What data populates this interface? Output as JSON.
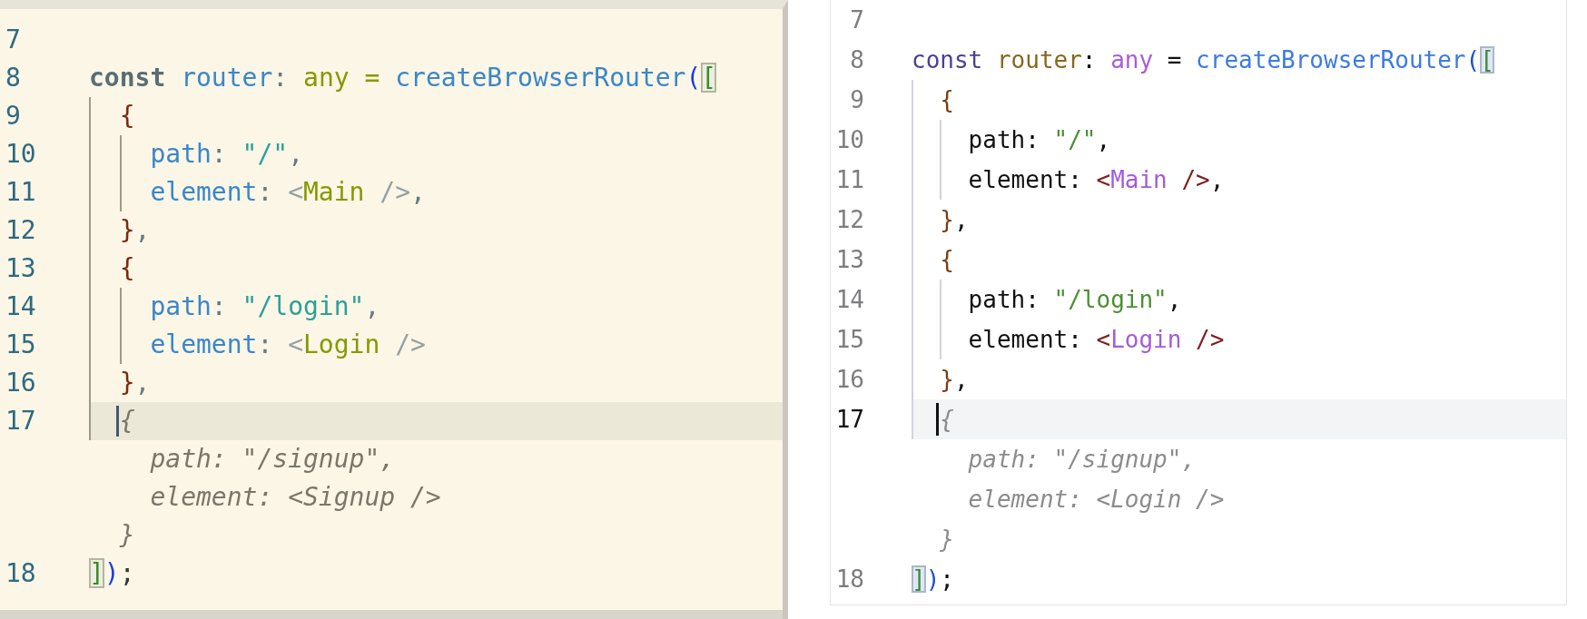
{
  "panes": [
    {
      "kind": "solarized",
      "lines": [
        {
          "number": "7",
          "current": false
        },
        {
          "number": "8",
          "current": false,
          "tokens": [
            {
              "text": "const",
              "kind": "kw"
            },
            {
              "text": " router",
              "kind": "var"
            },
            {
              "text": ": ",
              "kind": "punct"
            },
            {
              "text": "any",
              "kind": "type"
            },
            {
              "text": " = ",
              "kind": "op"
            },
            {
              "text": "createBrowserRouter",
              "kind": "fn"
            },
            {
              "text": "(",
              "kind": "paren"
            },
            {
              "text": "[",
              "kind": "match"
            }
          ]
        },
        {
          "number": "9",
          "current": false,
          "tokens": [
            {
              "text": "  {",
              "kind": "brace"
            }
          ]
        },
        {
          "number": "10",
          "current": false,
          "tokens": [
            {
              "text": "    path",
              "kind": "prop"
            },
            {
              "text": ": ",
              "kind": "punct"
            },
            {
              "text": "\"/\"",
              "kind": "str"
            },
            {
              "text": ",",
              "kind": "punct"
            }
          ]
        },
        {
          "number": "11",
          "current": false,
          "tokens": [
            {
              "text": "    element",
              "kind": "prop"
            },
            {
              "text": ": ",
              "kind": "punct"
            },
            {
              "text": "<",
              "kind": "tagp"
            },
            {
              "text": "Main",
              "kind": "comp"
            },
            {
              "text": " />",
              "kind": "tagp"
            },
            {
              "text": ",",
              "kind": "punct"
            }
          ]
        },
        {
          "number": "12",
          "current": false,
          "tokens": [
            {
              "text": "  }",
              "kind": "brace"
            },
            {
              "text": ",",
              "kind": "punct"
            }
          ]
        },
        {
          "number": "13",
          "current": false,
          "tokens": [
            {
              "text": "  {",
              "kind": "brace"
            }
          ]
        },
        {
          "number": "14",
          "current": false,
          "tokens": [
            {
              "text": "    path",
              "kind": "prop"
            },
            {
              "text": ": ",
              "kind": "punct"
            },
            {
              "text": "\"/login\"",
              "kind": "str"
            },
            {
              "text": ",",
              "kind": "punct"
            }
          ]
        },
        {
          "number": "15",
          "current": false,
          "tokens": [
            {
              "text": "    element",
              "kind": "prop"
            },
            {
              "text": ": ",
              "kind": "punct"
            },
            {
              "text": "<",
              "kind": "tagp"
            },
            {
              "text": "Login",
              "kind": "comp"
            },
            {
              "text": " />",
              "kind": "tagp"
            }
          ]
        },
        {
          "number": "16",
          "current": false,
          "tokens": [
            {
              "text": "  }",
              "kind": "brace"
            },
            {
              "text": ",",
              "kind": "punct"
            }
          ]
        },
        {
          "number": "17",
          "current": true,
          "tokens": [
            {
              "text": "  {",
              "kind": "ghost"
            }
          ]
        },
        {
          "current": false,
          "tokens": [
            {
              "text": "    path: \"/signup\",",
              "kind": "ghost"
            }
          ]
        },
        {
          "current": false,
          "tokens": [
            {
              "text": "    element: <Signup />",
              "kind": "ghost"
            }
          ]
        },
        {
          "current": false,
          "tokens": [
            {
              "text": "  }",
              "kind": "ghost"
            }
          ]
        },
        {
          "number": "18",
          "current": false,
          "tokens": [
            {
              "text": "]",
              "kind": "match"
            },
            {
              "text": ")",
              "kind": "paren"
            },
            {
              "text": ";",
              "kind": "end"
            }
          ]
        }
      ]
    },
    {
      "kind": "light",
      "lines": [
        {
          "number": "7",
          "current": false
        },
        {
          "number": "8",
          "current": false,
          "tokens": [
            {
              "text": "const",
              "kind": "kw"
            },
            {
              "text": " router",
              "kind": "var"
            },
            {
              "text": ": ",
              "kind": "punct"
            },
            {
              "text": "any",
              "kind": "type"
            },
            {
              "text": " = ",
              "kind": "op"
            },
            {
              "text": "createBrowserRouter",
              "kind": "fn"
            },
            {
              "text": "(",
              "kind": "paren"
            },
            {
              "text": "[",
              "kind": "match"
            }
          ]
        },
        {
          "number": "9",
          "current": false,
          "tokens": [
            {
              "text": "  {",
              "kind": "brace"
            }
          ]
        },
        {
          "number": "10",
          "current": false,
          "tokens": [
            {
              "text": "    path",
              "kind": "prop"
            },
            {
              "text": ": ",
              "kind": "punct"
            },
            {
              "text": "\"/\"",
              "kind": "str"
            },
            {
              "text": ",",
              "kind": "punct"
            }
          ]
        },
        {
          "number": "11",
          "current": false,
          "tokens": [
            {
              "text": "    element",
              "kind": "prop"
            },
            {
              "text": ": ",
              "kind": "punct"
            },
            {
              "text": "<",
              "kind": "tagp"
            },
            {
              "text": "Main",
              "kind": "comp"
            },
            {
              "text": " />",
              "kind": "tagp"
            },
            {
              "text": ",",
              "kind": "punct"
            }
          ]
        },
        {
          "number": "12",
          "current": false,
          "tokens": [
            {
              "text": "  }",
              "kind": "brace"
            },
            {
              "text": ",",
              "kind": "punct"
            }
          ]
        },
        {
          "number": "13",
          "current": false,
          "tokens": [
            {
              "text": "  {",
              "kind": "brace"
            }
          ]
        },
        {
          "number": "14",
          "current": false,
          "tokens": [
            {
              "text": "    path",
              "kind": "prop"
            },
            {
              "text": ": ",
              "kind": "punct"
            },
            {
              "text": "\"/login\"",
              "kind": "str"
            },
            {
              "text": ",",
              "kind": "punct"
            }
          ]
        },
        {
          "number": "15",
          "current": false,
          "tokens": [
            {
              "text": "    element",
              "kind": "prop"
            },
            {
              "text": ": ",
              "kind": "punct"
            },
            {
              "text": "<",
              "kind": "tagp"
            },
            {
              "text": "Login",
              "kind": "comp"
            },
            {
              "text": " />",
              "kind": "tagp"
            }
          ]
        },
        {
          "number": "16",
          "current": false,
          "tokens": [
            {
              "text": "  }",
              "kind": "brace"
            },
            {
              "text": ",",
              "kind": "punct"
            }
          ]
        },
        {
          "number": "17",
          "current": true,
          "tokens": [
            {
              "text": "  {",
              "kind": "ghost"
            }
          ]
        },
        {
          "current": false,
          "tokens": [
            {
              "text": "    path: \"/signup\",",
              "kind": "ghost"
            }
          ]
        },
        {
          "current": false,
          "tokens": [
            {
              "text": "    element: <Login />",
              "kind": "ghost"
            }
          ]
        },
        {
          "current": false,
          "tokens": [
            {
              "text": "  }",
              "kind": "ghost"
            }
          ]
        },
        {
          "number": "18",
          "current": false,
          "tokens": [
            {
              "text": "]",
              "kind": "match"
            },
            {
              "text": ")",
              "kind": "paren"
            },
            {
              "text": ";",
              "kind": "end"
            }
          ]
        }
      ]
    }
  ]
}
